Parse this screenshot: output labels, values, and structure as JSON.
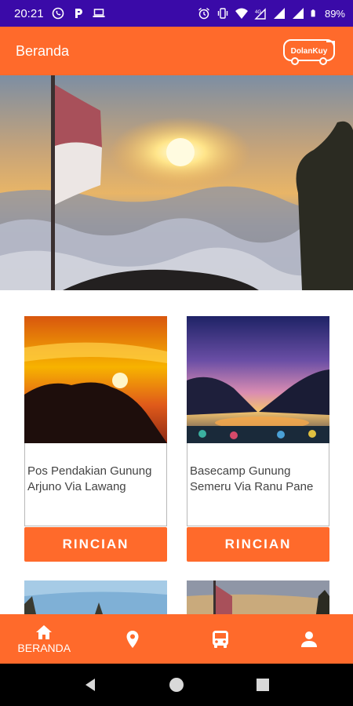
{
  "status_bar": {
    "time": "20:21",
    "battery": "89%",
    "left_icons": [
      "whatsapp-icon",
      "parking-icon",
      "laptop-icon"
    ],
    "right_icons": [
      "alarm-icon",
      "vibrate-icon",
      "wifi-icon",
      "cellular-data-icon",
      "signal-icon",
      "signal-icon",
      "battery-icon"
    ]
  },
  "app_bar": {
    "title": "Beranda",
    "logo_text": "DolanKuy"
  },
  "carousel": {
    "slide_count": 4,
    "active_index": 0
  },
  "destinations": [
    {
      "name": "Pos Pendakian Gunung Arjuno Via Lawang",
      "button": "RINCIAN"
    },
    {
      "name": "Basecamp Gunung Semeru Via Ranu Pane",
      "button": "RINCIAN"
    }
  ],
  "bottom_nav": {
    "items": [
      {
        "label": "BERANDA",
        "icon": "home-icon",
        "active": true
      },
      {
        "label": "",
        "icon": "location-pin-icon",
        "active": false
      },
      {
        "label": "",
        "icon": "bus-icon",
        "active": false
      },
      {
        "label": "",
        "icon": "person-icon",
        "active": false
      }
    ]
  },
  "colors": {
    "status_bar": "#3a0aa8",
    "accent": "#ff6a2b",
    "system_nav": "#000000"
  }
}
